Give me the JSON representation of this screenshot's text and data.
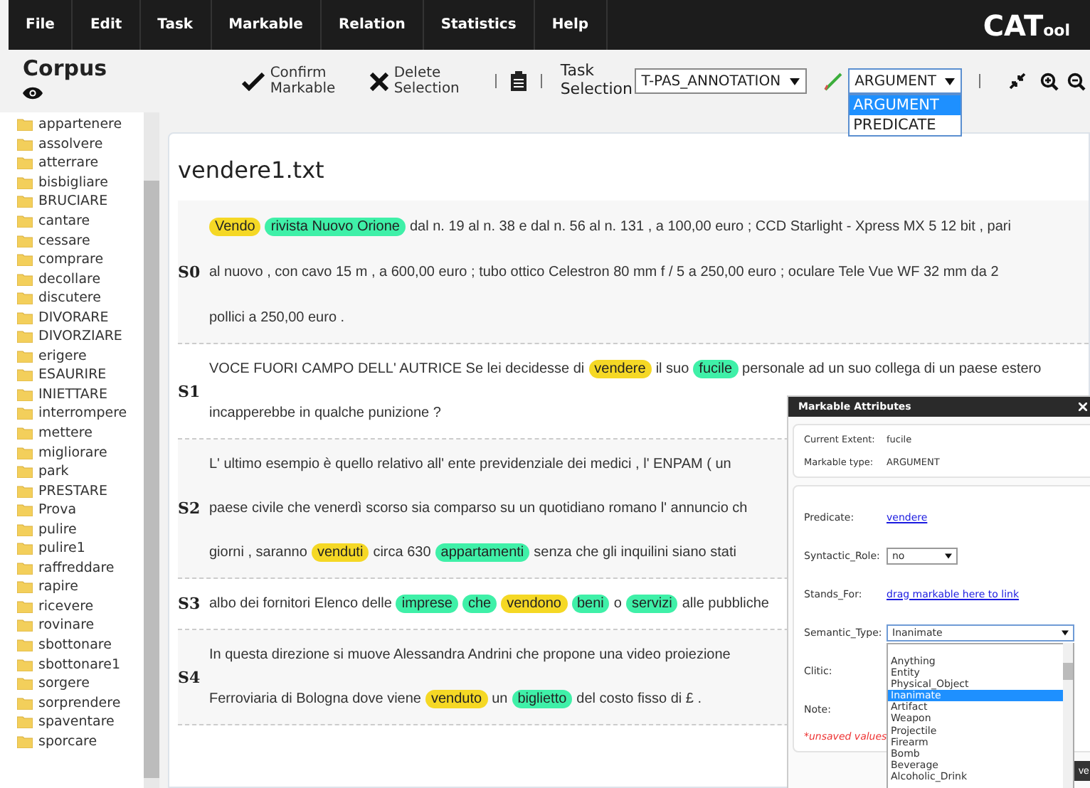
{
  "menu": [
    "File",
    "Edit",
    "Task",
    "Markable",
    "Relation",
    "Statistics",
    "Help"
  ],
  "logo": {
    "main": "CAT",
    "suffix": "ool"
  },
  "corpus": {
    "title": "Corpus",
    "files": [
      "appartenere",
      "assolvere",
      "atterrare",
      "bisbigliare",
      "BRUCIARE",
      "cantare",
      "cessare",
      "comprare",
      "decollare",
      "discutere",
      "DIVORARE",
      "DIVORZIARE",
      "erigere",
      "ESAURIRE",
      "INIETTARE",
      "interrompere",
      "mettere",
      "migliorare",
      "park",
      "PRESTARE",
      "Prova",
      "pulire",
      "pulire1",
      "raffreddare",
      "rapire",
      "ricevere",
      "rovinare",
      "sbottonare",
      "sbottonare1",
      "sorgere",
      "sorprendere",
      "spaventare",
      "sporcare"
    ]
  },
  "toolbar": {
    "confirm": "Confirm Markable",
    "delete": "Delete Selection",
    "task_label": "Task Selection",
    "task_select": "T-PAS_ANNOTATION",
    "markable_select": {
      "value": "ARGUMENT",
      "expanded": true,
      "options": [
        {
          "label": "ARGUMENT",
          "selected": true
        },
        {
          "label": "PREDICATE",
          "selected": false
        }
      ]
    }
  },
  "document": {
    "title": "vendere1.txt",
    "sentences": [
      {
        "id": "S0",
        "lines": [
          [
            {
              "kind": "predicate",
              "text": "Vendo"
            },
            {
              "kind": "argument",
              "text": "rivista Nuovo Orione"
            },
            {
              "kind": "text",
              "text": "dal n. 19 al n. 38 e dal n. 56 al n. 131 , a 100,00 euro ; CCD Starlight - Xpress MX 5 12 bit , pari"
            }
          ],
          [
            {
              "kind": "text",
              "text": "al nuovo , con cavo 15 m , a 600,00 euro ; tubo ottico Celestron 80 mm f / 5 a 250,00 euro ; oculare Tele Vue WF 32 mm da 2"
            }
          ],
          [
            {
              "kind": "text",
              "text": "pollici a 250,00 euro ."
            }
          ]
        ]
      },
      {
        "id": "S1",
        "lines": [
          [
            {
              "kind": "text",
              "text": "VOCE FUORI CAMPO DELL' AUTRICE Se lei decidesse di"
            },
            {
              "kind": "predicate",
              "text": "vendere"
            },
            {
              "kind": "text",
              "text": "il suo"
            },
            {
              "kind": "argument",
              "text": "fucile"
            },
            {
              "kind": "text",
              "text": "personale ad un suo collega di un paese estero"
            }
          ],
          [
            {
              "kind": "text",
              "text": "incapperebbe in qualche punizione ?"
            }
          ]
        ]
      },
      {
        "id": "S2",
        "lines": [
          [
            {
              "kind": "text",
              "text": "L' ultimo esempio è quello relativo all' ente previdenziale dei medici , l' ENPAM ( un"
            }
          ],
          [
            {
              "kind": "text",
              "text": "paese civile che venerdì scorso sia comparso su un quotidiano romano l' annuncio ch"
            }
          ],
          [
            {
              "kind": "text",
              "text": "giorni , saranno"
            },
            {
              "kind": "predicate",
              "text": "venduti"
            },
            {
              "kind": "text",
              "text": "circa 630"
            },
            {
              "kind": "argument",
              "text": "appartamenti"
            },
            {
              "kind": "text",
              "text": "senza che gli inquilini siano stati"
            }
          ]
        ]
      },
      {
        "id": "S3",
        "lines": [
          [
            {
              "kind": "text",
              "text": "albo dei fornitori Elenco delle"
            },
            {
              "kind": "argument",
              "text": "imprese"
            },
            {
              "kind": "argument",
              "text": "che"
            },
            {
              "kind": "predicate",
              "text": "vendono"
            },
            {
              "kind": "argument",
              "text": "beni"
            },
            {
              "kind": "text",
              "text": "o"
            },
            {
              "kind": "argument",
              "text": "servizi"
            },
            {
              "kind": "text",
              "text": "alle pubbliche"
            }
          ]
        ]
      },
      {
        "id": "S4",
        "lines": [
          [
            {
              "kind": "text",
              "text": "In questa direzione si muove Alessandra Andrini che propone una video proiezione"
            }
          ],
          [
            {
              "kind": "text",
              "text": "Ferroviaria di Bologna dove viene"
            },
            {
              "kind": "predicate",
              "text": "venduto"
            },
            {
              "kind": "text",
              "text": "un"
            },
            {
              "kind": "argument",
              "text": "biglietto"
            },
            {
              "kind": "text",
              "text": "del costo fisso di £ ."
            }
          ]
        ]
      }
    ]
  },
  "dialog": {
    "title": "Markable Attributes",
    "info": [
      {
        "label": "Current Extent:",
        "value": "fucile"
      },
      {
        "label": "Markable type:",
        "value": "ARGUMENT"
      }
    ],
    "fields": [
      {
        "kind": "link",
        "label": "Predicate:",
        "value": "vendere"
      },
      {
        "kind": "select",
        "label": "Syntactic_Role:",
        "value": "no"
      },
      {
        "kind": "link",
        "label": "Stands_For:",
        "value": "drag markable here to link"
      },
      {
        "kind": "select",
        "label": "Semantic_Type:",
        "value": "Inanimate",
        "expanded": true,
        "options": [
          {
            "label": "Anything",
            "selected": false
          },
          {
            "label": "Entity",
            "selected": false
          },
          {
            "label": "Physical_Object",
            "selected": false
          },
          {
            "label": "Inanimate",
            "selected": true
          },
          {
            "label": "Artifact",
            "selected": false
          },
          {
            "label": "Weapon",
            "selected": false
          },
          {
            "label": "Projectile",
            "selected": false
          },
          {
            "label": "Firearm",
            "selected": false
          },
          {
            "label": "Bomb",
            "selected": false
          },
          {
            "label": "Beverage",
            "selected": false
          },
          {
            "label": "Alcoholic_Drink",
            "selected": false
          }
        ]
      },
      {
        "kind": "label",
        "label": "Clitic:"
      },
      {
        "kind": "label",
        "label": "Note:"
      }
    ],
    "warning": "*unsaved values",
    "button": "ve"
  }
}
